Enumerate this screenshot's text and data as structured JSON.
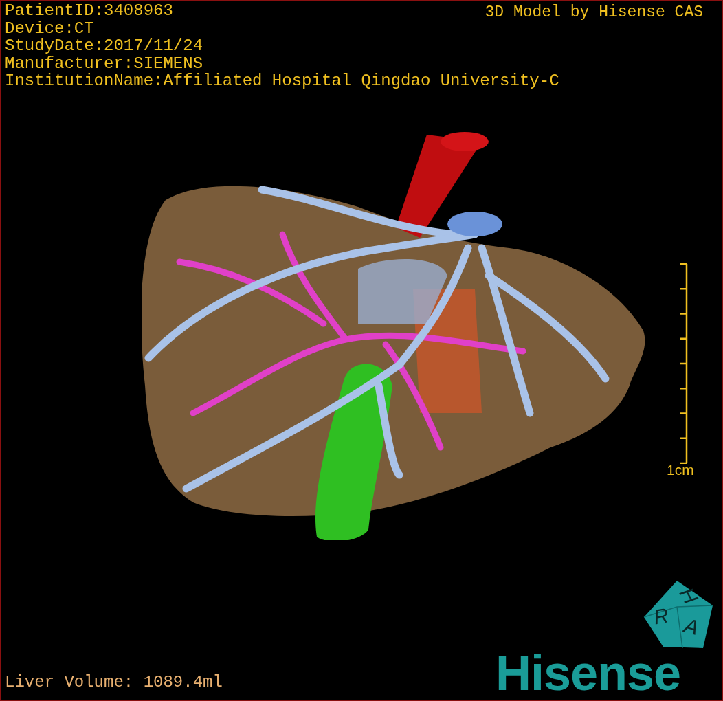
{
  "study_info": [
    "PatientID:3408963",
    "Device:CT",
    "StudyDate:2017/11/24",
    "Manufacturer:SIEMENS",
    "InstitutionName:Affiliated Hospital Qingdao University-C"
  ],
  "credit": "3D Model by Hisense CAS",
  "scale_bar": {
    "label": "1cm"
  },
  "orientation_cube": {
    "faces": [
      "H",
      "R",
      "A"
    ]
  },
  "logo": "Hisense",
  "measurement": "Liver Volume: 1089.4ml"
}
